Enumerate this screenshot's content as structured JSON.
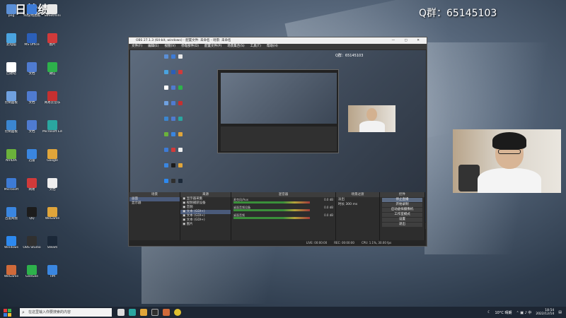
{
  "overlay": {
    "title_left": "7日战绩:",
    "qq_group": "Q群：65145103"
  },
  "desktop_icons": [
    {
      "label": "png",
      "color": "#5b8fd6"
    },
    {
      "label": "3D游戏图纸",
      "color": "#3d7bd6"
    },
    {
      "label": "Sweetmini",
      "color": "#e8e8e8"
    },
    {
      "label": "此电脑",
      "color": "#4aa3df"
    },
    {
      "label": "MS Office",
      "color": "#2b5fb8"
    },
    {
      "label": "图片",
      "color": "#d13a3a"
    },
    {
      "label": "回收站",
      "color": "#ffffff"
    },
    {
      "label": "文档",
      "color": "#4f7bd0"
    },
    {
      "label": "微信",
      "color": "#2db14b"
    },
    {
      "label": "控制面板",
      "color": "#6fa1e0"
    },
    {
      "label": "文档",
      "color": "#4f7bd0"
    },
    {
      "label": "网易云音乐",
      "color": "#c53030"
    },
    {
      "label": "控制面板",
      "color": "#3b86d0"
    },
    {
      "label": "文档",
      "color": "#4f7bd0"
    },
    {
      "label": "Microsoft Edge",
      "color": "#2aa6a0"
    },
    {
      "label": "NVIDIA",
      "color": "#6bb23b"
    },
    {
      "label": "迅雷",
      "color": "#3a86e0"
    },
    {
      "label": "Google",
      "color": "#e0a53a"
    },
    {
      "label": "Microsoft",
      "color": "#3d7bd6"
    },
    {
      "label": "网易",
      "color": "#d13a3a"
    },
    {
      "label": "文档",
      "color": "#eeeeee"
    },
    {
      "label": "百度网盘",
      "color": "#3a86e0"
    },
    {
      "label": "QQ",
      "color": "#1c1c1c"
    },
    {
      "label": "WeGame",
      "color": "#e0a53a"
    },
    {
      "label": "Windows",
      "color": "#2d89ef"
    },
    {
      "label": "OBS Studio",
      "color": "#303030"
    },
    {
      "label": "Steam",
      "color": "#1b2838"
    },
    {
      "label": "WeGame",
      "color": "#d06a3a"
    },
    {
      "label": "GeeGee",
      "color": "#2db14b"
    },
    {
      "label": "TIM",
      "color": "#3a86e0"
    }
  ],
  "obs": {
    "window_title": "OBS 27.1.3 (64-bit, windows) - 配置文件: 未命名 - 场景: 未命名",
    "menu": [
      "文件(F)",
      "编辑(E)",
      "视图(V)",
      "停靠部件(D)",
      "配置文件(P)",
      "场景集合(S)",
      "工具(T)",
      "帮助(H)"
    ],
    "nested_qq": "Q群：65145103",
    "toolbar": {
      "source_label": "文本 (GDI+) 1",
      "properties": "属性",
      "filters": "滤镜",
      "select_text": "选择文本",
      "text_label": "选择颜色",
      "read_from_file": "从文件读取"
    },
    "docks": {
      "scenes": "场景",
      "sources": "来源",
      "mixer": "混音器",
      "transitions": "场景过渡",
      "controls": "控件"
    },
    "scenes": [
      "画面",
      "显示器"
    ],
    "sources": [
      "显示器采集",
      "视频捕获设备",
      "音频",
      "文本 (GDI+)",
      "文本 (GDI+)",
      "文本 (GDI+)",
      "图片"
    ],
    "mixer": [
      {
        "name": "麦克风/Aux",
        "level": "0.0 dB"
      },
      {
        "name": "桌面音频设备",
        "level": "0.0 dB"
      },
      {
        "name": "桌面音频",
        "level": "0.0 dB"
      }
    ],
    "transitions": {
      "type": "淡出",
      "duration_label": "时长",
      "duration_value": "300 ms"
    },
    "controls": [
      "停止直播",
      "开始录制",
      "启动虚拟摄像机",
      "工作室模式",
      "设置",
      "退出"
    ],
    "status": {
      "live": "LIVE: 00:00:00",
      "rec": "REC: 00:00:00",
      "cpu": "CPU: 1.1%, 30.00 fps"
    }
  },
  "taskbar": {
    "search_placeholder": "在这里输入你要搜索的内容",
    "weather": "10°C 晴朗",
    "time": "18:54",
    "date": "2022/12/14"
  }
}
